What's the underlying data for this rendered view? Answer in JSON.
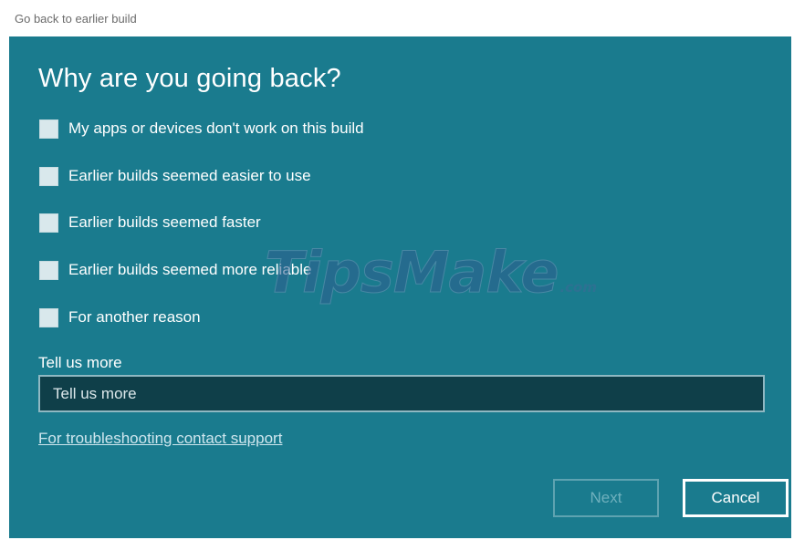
{
  "window": {
    "title": "Go back to earlier build"
  },
  "dialog": {
    "heading": "Why are you going back?",
    "options": [
      {
        "label": "My apps or devices don't work on this build",
        "checked": false
      },
      {
        "label": "Earlier builds seemed easier to use",
        "checked": false
      },
      {
        "label": "Earlier builds seemed faster",
        "checked": false
      },
      {
        "label": "Earlier builds seemed more reliable",
        "checked": false
      },
      {
        "label": "For another reason",
        "checked": false
      }
    ],
    "feedback": {
      "label": "Tell us more",
      "placeholder": "Tell us more",
      "value": ""
    },
    "support_link": "For troubleshooting contact support",
    "buttons": {
      "next": "Next",
      "cancel": "Cancel"
    },
    "next_enabled": false
  },
  "watermark": {
    "main": "TipsMake",
    "suffix": ".com"
  },
  "colors": {
    "panel_background": "#1a7b8e",
    "input_background": "#0f3f49",
    "checkbox_fill": "#d9e8ec",
    "text": "#ffffff"
  }
}
